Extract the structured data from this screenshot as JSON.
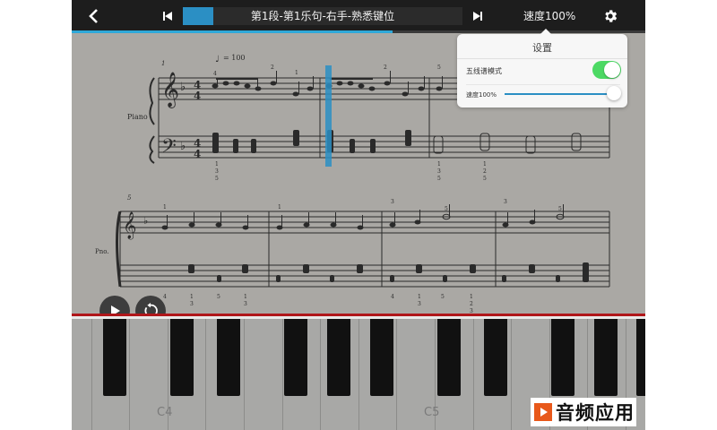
{
  "topbar": {
    "segment_title": "第1段-第1乐句-右手-熟悉键位",
    "speed_label": "速度100%",
    "progress": 0.56,
    "segment_progress": 0.11
  },
  "score": {
    "tempo": "= 100",
    "instrument_1": "Piano",
    "instrument_2": "Pno.",
    "measure_1": "1",
    "measure_5": "5"
  },
  "settings": {
    "title": "设置",
    "staff_mode_label": "五线谱模式",
    "staff_mode_on": true,
    "speed_label": "速度100%",
    "speed_value": 1.0
  },
  "keyboard": {
    "labels": [
      "C4",
      "C5"
    ]
  },
  "colors": {
    "accent": "#2b8fc4",
    "toggle_on": "#4cd964",
    "keyboard_edge": "#b0161a"
  },
  "icons": {
    "back": "chevron-left-icon",
    "prev": "skip-previous-icon",
    "next": "skip-next-icon",
    "settings": "gear-icon",
    "play": "play-icon",
    "reset": "reset-icon"
  },
  "watermark": {
    "text": "音频应用"
  }
}
